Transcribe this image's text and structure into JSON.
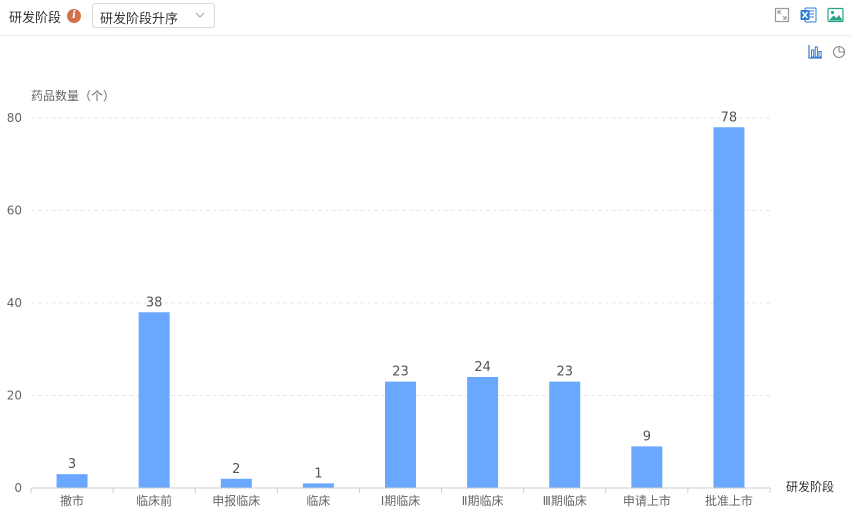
{
  "toolbar": {
    "label": "研发阶段",
    "info_icon": "info-icon",
    "sort_value": "研发阶段升序",
    "icons": [
      "fullscreen-icon",
      "excel-export-icon",
      "image-export-icon"
    ]
  },
  "view_switch": {
    "icons": [
      "bar-chart-icon",
      "pie-chart-icon"
    ]
  },
  "colors": {
    "bar": "#6aa7ff",
    "info_badge": "#d3714f",
    "excel_blue": "#2b7cd3",
    "image_green": "#29a387",
    "axis_text": "#666666",
    "grid": "#e4e7ed"
  },
  "chart_data": {
    "type": "bar",
    "title": "",
    "xlabel": "研发阶段",
    "ylabel": "药品数量（个）",
    "categories": [
      "撤市",
      "临床前",
      "申报临床",
      "临床",
      "Ⅰ期临床",
      "Ⅱ期临床",
      "Ⅲ期临床",
      "申请上市",
      "批准上市"
    ],
    "values": [
      3,
      38,
      2,
      1,
      23,
      24,
      23,
      9,
      78
    ],
    "ylim": [
      0,
      80
    ],
    "yticks": [
      0,
      20,
      40,
      60,
      80
    ],
    "grid": true,
    "data_labels": true
  }
}
